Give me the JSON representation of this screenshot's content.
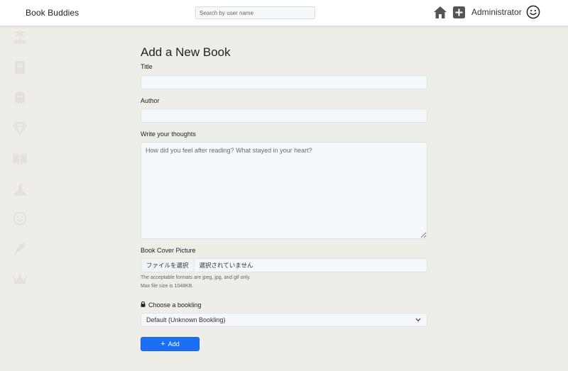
{
  "header": {
    "brand": "Book Buddies",
    "search_placeholder": "Search by user name",
    "user_name": "Administrator"
  },
  "sidebar": {
    "items": [
      {
        "icon": "island-icon"
      },
      {
        "icon": "book-icon"
      },
      {
        "icon": "ghost-icon"
      },
      {
        "icon": "gem-icon"
      },
      {
        "icon": "open-book-icon"
      },
      {
        "icon": "wizard-hat-icon"
      },
      {
        "icon": "smile-icon"
      },
      {
        "icon": "feather-icon"
      },
      {
        "icon": "crown-icon"
      }
    ]
  },
  "form": {
    "title": "Add a New Book",
    "title_label": "Title",
    "title_value": "",
    "author_label": "Author",
    "author_value": "",
    "thoughts_label": "Write your thoughts",
    "thoughts_placeholder": "How did you feel after reading? What stayed in your heart?",
    "cover_label": "Book Cover Picture",
    "file_button": "ファイルを選択",
    "file_status": "選択されていません",
    "formats_help": "The acceptable formats are jpeg, jpg, and gif only.",
    "size_help": "Max file size is 1048KB.",
    "bookling_label": "Choose a bookling",
    "bookling_selected": "Default (Unknown Bookling)",
    "submit_label": "Add"
  },
  "colors": {
    "background": "#efede8",
    "accent": "#1b6ff5",
    "sidebar_icon": "#e5e1da"
  }
}
